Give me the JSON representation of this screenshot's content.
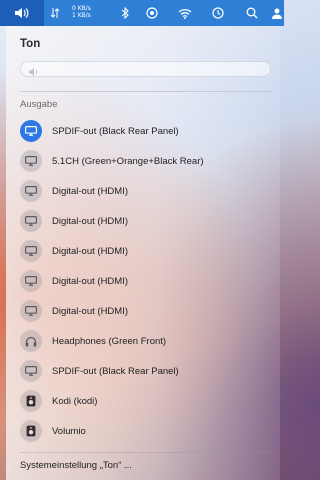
{
  "menubar": {
    "netspeed_up": "0 KB/s",
    "netspeed_down": "1 KB/s",
    "icons": [
      "volume-icon",
      "network-speed-icon",
      "bluetooth-icon",
      "focus-icon",
      "wifi-icon",
      "clock-icon",
      "search-icon",
      "user-icon"
    ]
  },
  "sound_menu": {
    "title": "Ton",
    "volume_level": 0.0,
    "output_header": "Ausgabe",
    "devices": [
      {
        "label": "SPDIF-out (Black Rear Panel)",
        "icon": "display-icon",
        "selected": true
      },
      {
        "label": "5.1CH (Green+Orange+Black Rear)",
        "icon": "display-icon",
        "selected": false
      },
      {
        "label": "Digital-out (HDMI)",
        "icon": "display-icon",
        "selected": false
      },
      {
        "label": "Digital-out (HDMI)",
        "icon": "display-icon",
        "selected": false
      },
      {
        "label": "Digital-out (HDMI)",
        "icon": "display-icon",
        "selected": false
      },
      {
        "label": "Digital-out (HDMI)",
        "icon": "display-icon",
        "selected": false
      },
      {
        "label": "Digital-out (HDMI)",
        "icon": "display-icon",
        "selected": false
      },
      {
        "label": "Headphones (Green Front)",
        "icon": "headphones-icon",
        "selected": false
      },
      {
        "label": "SPDIF-out (Black Rear Panel)",
        "icon": "display-icon",
        "selected": false
      },
      {
        "label": "Kodi (kodi)",
        "icon": "speaker-icon",
        "selected": false
      },
      {
        "label": "Volumio",
        "icon": "speaker-icon",
        "selected": false
      }
    ],
    "settings_link": "Systemeinstellung „Ton“ ..."
  },
  "colors": {
    "accent": "#2d77e6",
    "menubar": "#2f7fd6"
  }
}
